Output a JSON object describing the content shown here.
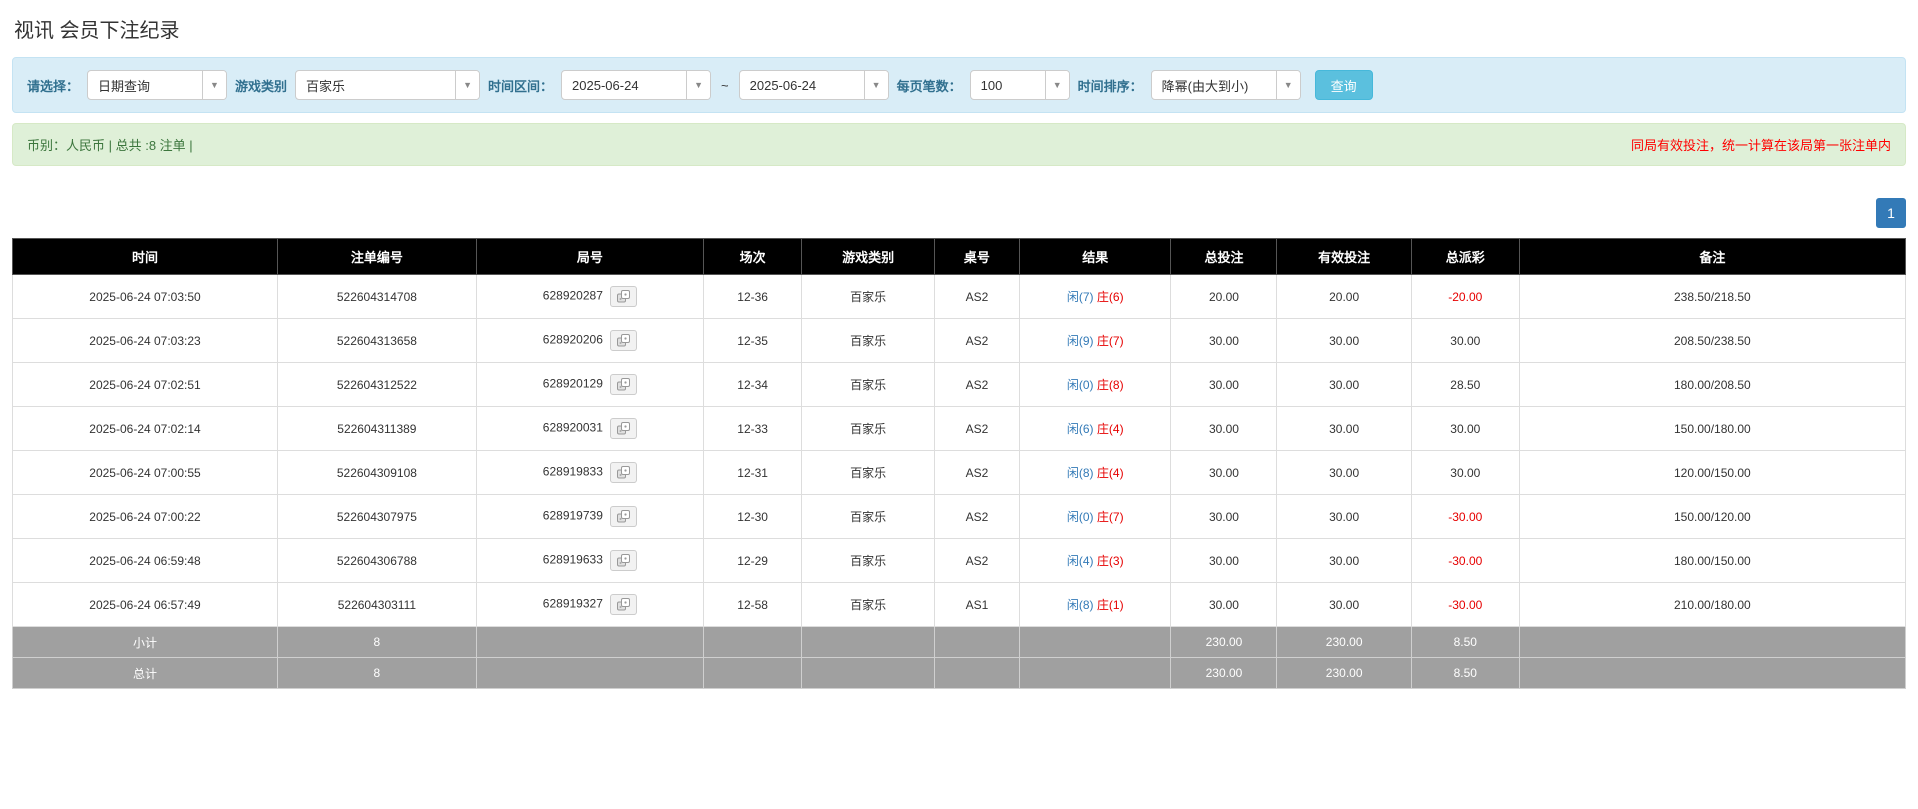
{
  "page": {
    "title": "视讯 会员下注纪录"
  },
  "filters": {
    "select_label": "请选择：",
    "select_value": "日期查询",
    "game_type_label": "游戏类别",
    "game_type_value": "百家乐",
    "date_range_label": "时间区间：",
    "date_from": "2025-06-24",
    "range_separator": "~",
    "date_to": "2025-06-24",
    "page_size_label": "每页笔数：",
    "page_size_value": "100",
    "sort_label": "时间排序：",
    "sort_value": "降幂(由大到小)",
    "search_button": "查询"
  },
  "summary": {
    "left": "币别：人民币 | 总共 :8 注单 |",
    "right": "同局有效投注，统一计算在该局第一张注单内"
  },
  "pagination": {
    "page": "1"
  },
  "table": {
    "headers": [
      "时间",
      "注单编号",
      "局号",
      "场次",
      "游戏类别",
      "桌号",
      "结果",
      "总投注",
      "有效投注",
      "总派彩",
      "备注"
    ],
    "rows": [
      {
        "time": "2025-06-24 07:03:50",
        "bet_no": "522604314708",
        "round_no": "628920287",
        "session": "12-36",
        "game": "百家乐",
        "table_no": "AS2",
        "result_player": "闲(7)",
        "result_banker": "庄(6)",
        "total_bet": "20.00",
        "valid_bet": "20.00",
        "payout": "-20.00",
        "note": "238.50/218.50"
      },
      {
        "time": "2025-06-24 07:03:23",
        "bet_no": "522604313658",
        "round_no": "628920206",
        "session": "12-35",
        "game": "百家乐",
        "table_no": "AS2",
        "result_player": "闲(9)",
        "result_banker": "庄(7)",
        "total_bet": "30.00",
        "valid_bet": "30.00",
        "payout": "30.00",
        "note": "208.50/238.50"
      },
      {
        "time": "2025-06-24 07:02:51",
        "bet_no": "522604312522",
        "round_no": "628920129",
        "session": "12-34",
        "game": "百家乐",
        "table_no": "AS2",
        "result_player": "闲(0)",
        "result_banker": "庄(8)",
        "total_bet": "30.00",
        "valid_bet": "30.00",
        "payout": "28.50",
        "note": "180.00/208.50"
      },
      {
        "time": "2025-06-24 07:02:14",
        "bet_no": "522604311389",
        "round_no": "628920031",
        "session": "12-33",
        "game": "百家乐",
        "table_no": "AS2",
        "result_player": "闲(6)",
        "result_banker": "庄(4)",
        "total_bet": "30.00",
        "valid_bet": "30.00",
        "payout": "30.00",
        "note": "150.00/180.00"
      },
      {
        "time": "2025-06-24 07:00:55",
        "bet_no": "522604309108",
        "round_no": "628919833",
        "session": "12-31",
        "game": "百家乐",
        "table_no": "AS2",
        "result_player": "闲(8)",
        "result_banker": "庄(4)",
        "total_bet": "30.00",
        "valid_bet": "30.00",
        "payout": "30.00",
        "note": "120.00/150.00"
      },
      {
        "time": "2025-06-24 07:00:22",
        "bet_no": "522604307975",
        "round_no": "628919739",
        "session": "12-30",
        "game": "百家乐",
        "table_no": "AS2",
        "result_player": "闲(0)",
        "result_banker": "庄(7)",
        "total_bet": "30.00",
        "valid_bet": "30.00",
        "payout": "-30.00",
        "note": "150.00/120.00"
      },
      {
        "time": "2025-06-24 06:59:48",
        "bet_no": "522604306788",
        "round_no": "628919633",
        "session": "12-29",
        "game": "百家乐",
        "table_no": "AS2",
        "result_player": "闲(4)",
        "result_banker": "庄(3)",
        "total_bet": "30.00",
        "valid_bet": "30.00",
        "payout": "-30.00",
        "note": "180.00/150.00"
      },
      {
        "time": "2025-06-24 06:57:49",
        "bet_no": "522604303111",
        "round_no": "628919327",
        "session": "12-58",
        "game": "百家乐",
        "table_no": "AS1",
        "result_player": "闲(8)",
        "result_banker": "庄(1)",
        "total_bet": "30.00",
        "valid_bet": "30.00",
        "payout": "-30.00",
        "note": "210.00/180.00"
      }
    ],
    "footer": [
      {
        "label": "小计",
        "count": "8",
        "total_bet": "230.00",
        "valid_bet": "230.00",
        "payout": "8.50"
      },
      {
        "label": "总计",
        "count": "8",
        "total_bet": "230.00",
        "valid_bet": "230.00",
        "payout": "8.50"
      }
    ]
  }
}
